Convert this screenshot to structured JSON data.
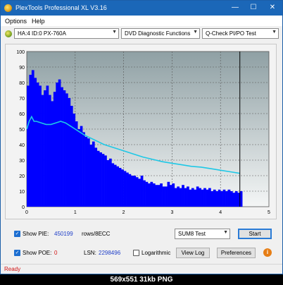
{
  "window": {
    "title": "PlexTools Professional XL V3.16",
    "minimize": "—",
    "maximize": "☐",
    "close": "✕"
  },
  "menu": {
    "items": [
      "Options",
      "Help"
    ]
  },
  "toolbar": {
    "drive": "HA:4 ID:0  PX-760A",
    "function": "DVD Diagnostic Functions",
    "test": "Q-Check PI/PO Test"
  },
  "chart_data": {
    "type": "bar",
    "title": "",
    "xlabel": "",
    "ylabel": "",
    "xlim": [
      0,
      5
    ],
    "ylim": [
      0,
      100
    ],
    "x_ticks": [
      "0",
      "1",
      "2",
      "3",
      "4",
      "5"
    ],
    "y_ticks": [
      "0",
      "10",
      "20",
      "30",
      "40",
      "50",
      "60",
      "70",
      "80",
      "90",
      "100"
    ],
    "end_marker_x": 4.4,
    "grid": true,
    "series": [
      {
        "kind": "bars",
        "color": "#0000ff",
        "x": [
          0.0,
          0.05,
          0.1,
          0.15,
          0.2,
          0.25,
          0.3,
          0.35,
          0.4,
          0.45,
          0.5,
          0.55,
          0.6,
          0.65,
          0.7,
          0.75,
          0.8,
          0.85,
          0.9,
          0.95,
          1.0,
          1.05,
          1.1,
          1.15,
          1.2,
          1.25,
          1.3,
          1.35,
          1.4,
          1.45,
          1.5,
          1.55,
          1.6,
          1.65,
          1.7,
          1.75,
          1.8,
          1.85,
          1.9,
          1.95,
          2.0,
          2.05,
          2.1,
          2.15,
          2.2,
          2.25,
          2.3,
          2.35,
          2.4,
          2.45,
          2.5,
          2.55,
          2.6,
          2.65,
          2.7,
          2.75,
          2.8,
          2.85,
          2.9,
          2.95,
          3.0,
          3.05,
          3.1,
          3.15,
          3.2,
          3.25,
          3.3,
          3.35,
          3.4,
          3.45,
          3.5,
          3.55,
          3.6,
          3.65,
          3.7,
          3.75,
          3.8,
          3.85,
          3.9,
          3.95,
          4.0,
          4.05,
          4.1,
          4.15,
          4.2,
          4.25,
          4.3,
          4.35,
          4.4
        ],
        "values": [
          78,
          85,
          88,
          83,
          80,
          78,
          72,
          75,
          78,
          72,
          68,
          74,
          80,
          82,
          77,
          75,
          73,
          70,
          65,
          60,
          55,
          50,
          52,
          48,
          45,
          44,
          40,
          42,
          38,
          36,
          35,
          34,
          33,
          30,
          31,
          28,
          27,
          26,
          25,
          24,
          23,
          22,
          21,
          20,
          20,
          19,
          18,
          20,
          17,
          16,
          15,
          16,
          15,
          14,
          14,
          15,
          13,
          13,
          16,
          14,
          15,
          12,
          13,
          12,
          14,
          12,
          13,
          11,
          12,
          11,
          13,
          12,
          11,
          12,
          11,
          12,
          10,
          11,
          10,
          11,
          10,
          11,
          10,
          11,
          10,
          9,
          10,
          9,
          10
        ]
      },
      {
        "kind": "line",
        "color": "#1ec8e6",
        "x": [
          0.0,
          0.05,
          0.1,
          0.15,
          0.2,
          0.3,
          0.4,
          0.5,
          0.6,
          0.7,
          0.8,
          0.9,
          1.0,
          1.1,
          1.2,
          1.4,
          1.6,
          1.8,
          2.0,
          2.2,
          2.4,
          2.6,
          2.8,
          3.0,
          3.2,
          3.4,
          3.6,
          3.8,
          4.0,
          4.2,
          4.4
        ],
        "values": [
          50,
          55,
          58,
          55,
          55,
          54,
          53,
          53,
          54,
          55,
          54,
          52,
          50,
          48,
          46,
          43,
          40,
          38,
          36,
          34,
          32,
          30.5,
          29,
          28,
          27,
          26,
          25.5,
          24.5,
          23.5,
          22.5,
          21.5
        ]
      }
    ]
  },
  "controls": {
    "show_pie_label": "Show PIE:",
    "pie_value": "450199",
    "pie_unit": "rows/8ECC",
    "show_poe_label": "Show POE:",
    "poe_value": "0",
    "lsn_label": "LSN:",
    "lsn_value": "2298496",
    "logarithmic_label": "Logarithmic",
    "mode_select": "SUM8 Test",
    "start_button": "Start",
    "view_log_button": "View Log",
    "preferences_button": "Preferences",
    "info_glyph": "i",
    "check_glyph": "✓"
  },
  "colors": {
    "accent": "#1b67b8",
    "status": "#d21414",
    "value_blue": "#1e3ec8",
    "value_red": "#d21414"
  },
  "status": {
    "text": "Ready"
  },
  "caption": {
    "text": "569x551  31kb  PNG"
  }
}
